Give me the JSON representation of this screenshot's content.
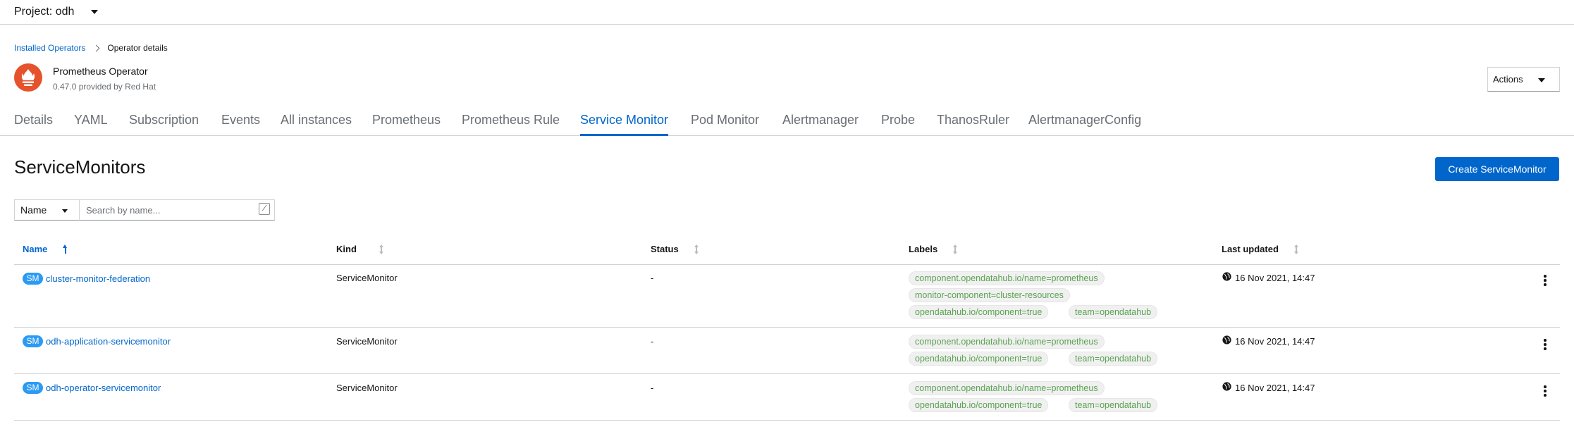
{
  "project": {
    "label": "Project: odh"
  },
  "breadcrumb": {
    "parent": "Installed Operators",
    "current": "Operator details"
  },
  "operator": {
    "name": "Prometheus Operator",
    "version": "0.47.0 provided by Red Hat"
  },
  "actions": {
    "label": "Actions"
  },
  "tabs": [
    {
      "label": "Details"
    },
    {
      "label": "YAML"
    },
    {
      "label": "Subscription"
    },
    {
      "label": "Events"
    },
    {
      "label": "All instances"
    },
    {
      "label": "Prometheus"
    },
    {
      "label": "Prometheus Rule"
    },
    {
      "label": "Service Monitor",
      "active": true
    },
    {
      "label": "Pod Monitor"
    },
    {
      "label": "Alertmanager"
    },
    {
      "label": "Probe"
    },
    {
      "label": "ThanosRuler"
    },
    {
      "label": "AlertmanagerConfig"
    }
  ],
  "page": {
    "title": "ServiceMonitors",
    "create_label": "Create ServiceMonitor"
  },
  "filter": {
    "type": "Name",
    "placeholder": "Search by name...",
    "shortcut": "/"
  },
  "table": {
    "columns": [
      {
        "label": "Name",
        "sorted": "asc"
      },
      {
        "label": "Kind"
      },
      {
        "label": "Status"
      },
      {
        "label": "Labels"
      },
      {
        "label": "Last updated"
      }
    ],
    "rows": [
      {
        "badge": "SM",
        "name": "cluster-monitor-federation",
        "kind": "ServiceMonitor",
        "status": "-",
        "labels": [
          "component.opendatahub.io/name=prometheus",
          "monitor-component=cluster-resources",
          "opendatahub.io/component=true",
          "team=opendatahub"
        ],
        "updated": "16 Nov 2021, 14:47"
      },
      {
        "badge": "SM",
        "name": "odh-application-servicemonitor",
        "kind": "ServiceMonitor",
        "status": "-",
        "labels": [
          "component.opendatahub.io/name=prometheus",
          "opendatahub.io/component=true",
          "team=opendatahub"
        ],
        "updated": "16 Nov 2021, 14:47"
      },
      {
        "badge": "SM",
        "name": "odh-operator-servicemonitor",
        "kind": "ServiceMonitor",
        "status": "-",
        "labels": [
          "component.opendatahub.io/name=prometheus",
          "opendatahub.io/component=true",
          "team=opendatahub"
        ],
        "updated": "16 Nov 2021, 14:47"
      }
    ]
  },
  "colors": {
    "accent": "#0066cc",
    "badge": "#2b9af3",
    "label_text": "#5ba352",
    "logo": "#e6522c"
  }
}
